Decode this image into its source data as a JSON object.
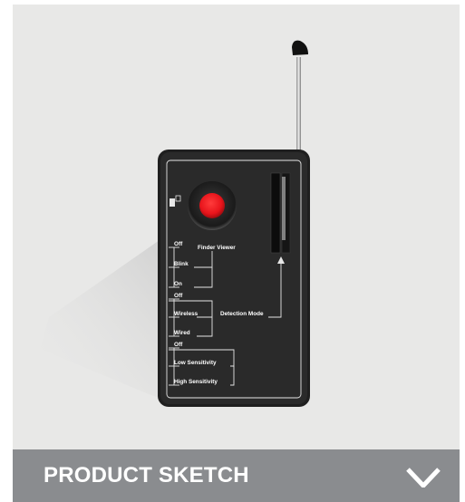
{
  "product_card": {
    "image_alt": "Camera detector device",
    "device_labels": {
      "finder_viewer": "Finder Viewer",
      "detection_mode": "Detection Mode",
      "group1": [
        "Off",
        "Blink",
        "On"
      ],
      "group2": [
        "Off",
        "Wireless",
        "Wired"
      ],
      "group3": [
        "Off",
        "Low Sensitivity",
        "High Sensitivity"
      ]
    },
    "band_title": "PRODUCT SKETCH",
    "chevron_icon": "chevron-down-icon",
    "colors": {
      "band": "#8a8c8f",
      "photo_bg": "#e8e8e7",
      "device_body": "#262626",
      "button_red": "#e8141b"
    }
  }
}
